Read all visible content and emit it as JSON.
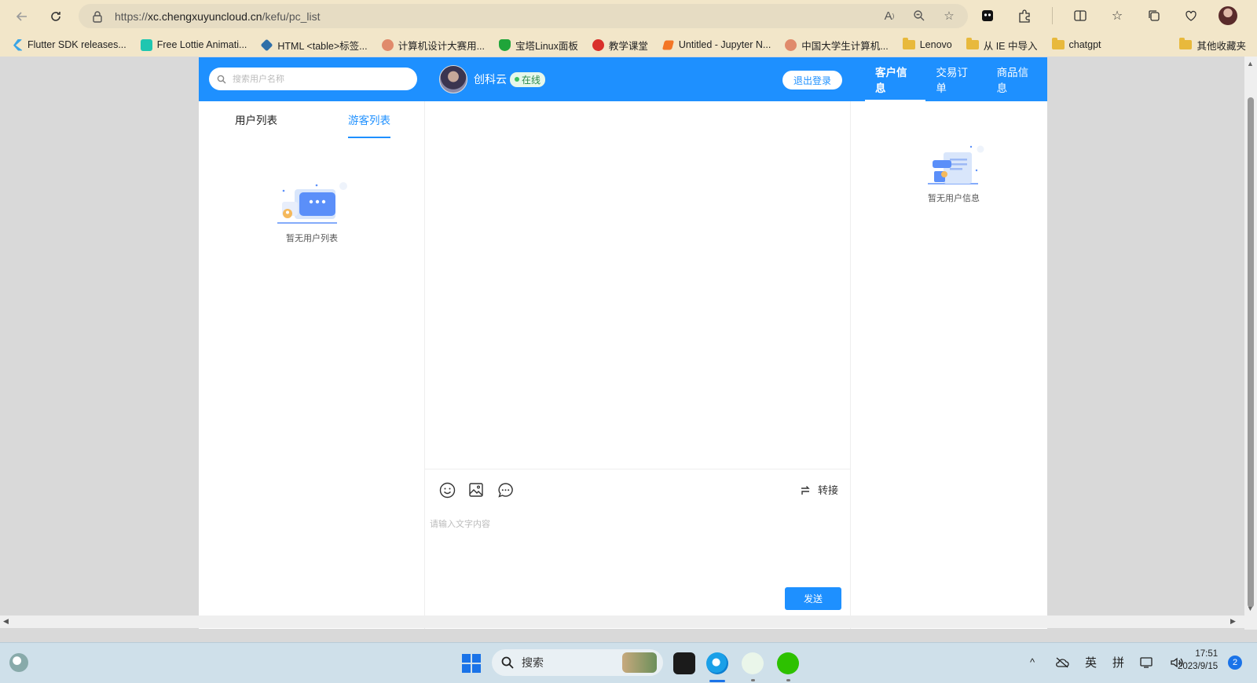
{
  "browser": {
    "url_prefix": "https://",
    "url_host": "xc.chengxuyuncloud.cn",
    "url_path": "/kefu/pc_list",
    "bookmarks": [
      {
        "label": "Flutter SDK releases...",
        "color": "#3aa5e6"
      },
      {
        "label": "Free Lottie Animati...",
        "color": "#1fc6b0"
      },
      {
        "label": "HTML <table>标签...",
        "color": "#2f6fa8"
      },
      {
        "label": "计算机设计大赛用...",
        "color": "#c54d3d"
      },
      {
        "label": "宝塔Linux面板",
        "color": "#20a53a"
      },
      {
        "label": "教学课堂",
        "color": "#d9302a"
      },
      {
        "label": "Untitled - Jupyter N...",
        "color": "#f37626"
      },
      {
        "label": "中国大学生计算机...",
        "color": "#c54d3d"
      },
      {
        "label": "Lenovo",
        "color": "folder"
      },
      {
        "label": "从 IE 中导入",
        "color": "folder"
      },
      {
        "label": "chatgpt",
        "color": "folder"
      }
    ],
    "other_bookmarks": "其他收藏夹"
  },
  "header": {
    "search_placeholder": "搜索用户名称",
    "agent_name": "创科云",
    "agent_status": "在线",
    "logout_label": "退出登录",
    "nav": [
      {
        "label": "客户信息",
        "active": true
      },
      {
        "label": "交易订单",
        "active": false
      },
      {
        "label": "商品信息",
        "active": false
      }
    ]
  },
  "left": {
    "tab_users": "用户列表",
    "tab_guests": "游客列表",
    "active_tab": "游客列表",
    "empty_text": "暂无用户列表"
  },
  "chat": {
    "transfer_label": "转接",
    "input_placeholder": "请输入文字内容",
    "send_label": "发送"
  },
  "right": {
    "empty_text": "暂无用户信息"
  },
  "taskbar": {
    "search_label": "搜索",
    "ime_lang": "英",
    "ime_mode": "拼",
    "time": "17:51",
    "date": "2023/9/15",
    "notifications": "2"
  },
  "colors": {
    "brand": "#1e90ff",
    "online": "#3cc063"
  }
}
